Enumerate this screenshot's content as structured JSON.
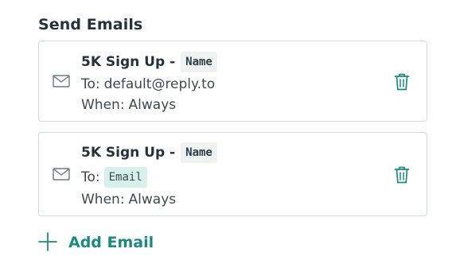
{
  "section": {
    "title": "Send Emails"
  },
  "emails": [
    {
      "title": "5K Sign Up -",
      "title_tag": "Name",
      "to_label": "To:",
      "to_value": "default@reply.to",
      "when_label": "When:",
      "when_value": "Always"
    },
    {
      "title": "5K Sign Up -",
      "title_tag": "Name",
      "to_label": "To:",
      "to_tag": "Email",
      "when_label": "When:",
      "when_value": "Always"
    }
  ],
  "add_email": {
    "label": "Add Email"
  },
  "icons": {
    "mail": "mail-icon",
    "trash": "trash-icon",
    "plus": "plus-icon"
  },
  "colors": {
    "accent": "#1b8a80",
    "tag_bg": "#eef2f1",
    "email_tag_bg": "#d7f0ec",
    "card_border": "#d4dadd"
  }
}
